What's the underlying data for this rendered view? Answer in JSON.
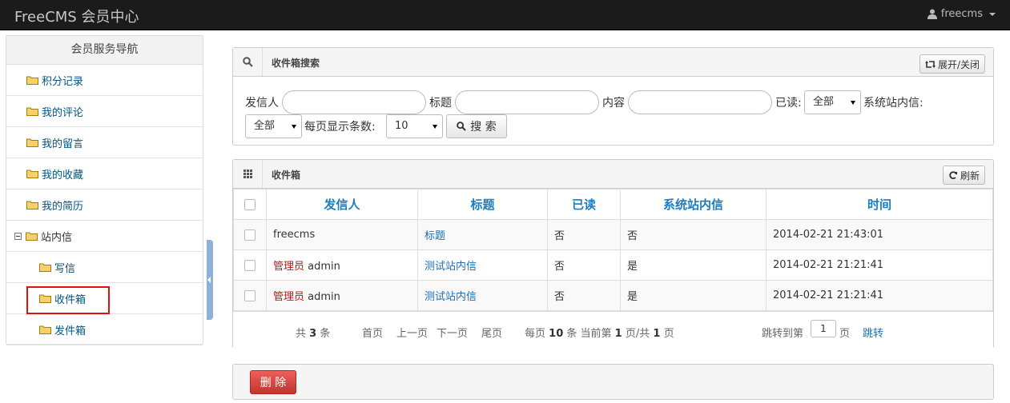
{
  "app": {
    "title": "FreeCMS 会员中心",
    "user": "freecms"
  },
  "sidebar": {
    "title": "会员服务导航",
    "items": [
      {
        "label": "积分记录"
      },
      {
        "label": "我的评论"
      },
      {
        "label": "我的留言"
      },
      {
        "label": "我的收藏"
      },
      {
        "label": "我的简历"
      },
      {
        "label": "站内信"
      },
      {
        "label": "写信"
      },
      {
        "label": "收件箱"
      },
      {
        "label": "发件箱"
      }
    ],
    "active": "收件箱"
  },
  "search": {
    "title": "收件箱搜索",
    "toggle_label": "展开/关闭",
    "sender_label": "发信人",
    "title_label": "标题",
    "content_label": "内容",
    "read_label": "已读:",
    "read_value": "全部",
    "system_label": "系统站内信:",
    "system_value": "全部",
    "pagesize_label": "每页显示条数:",
    "pagesize_value": "10",
    "search_button": "搜 索"
  },
  "list": {
    "title": "收件箱",
    "refresh_label": "刷新",
    "columns": [
      "发信人",
      "标题",
      "已读",
      "系统站内信",
      "时间"
    ],
    "rows": [
      {
        "sender_role": "",
        "sender": "freecms",
        "title": "标题",
        "read": "否",
        "system": "否",
        "time": "2014-02-21 21:43:01"
      },
      {
        "sender_role": "管理员",
        "sender": "admin",
        "title": "测试站内信",
        "read": "否",
        "system": "是",
        "time": "2014-02-21 21:21:41"
      },
      {
        "sender_role": "管理员",
        "sender": "admin",
        "title": "测试站内信",
        "read": "否",
        "system": "是",
        "time": "2014-02-21 21:21:41"
      }
    ]
  },
  "pager": {
    "total_prefix": "共",
    "total": "3",
    "total_suffix": "条",
    "first": "首页",
    "prev": "上一页",
    "next": "下一页",
    "last": "尾页",
    "per_page_prefix": "每页",
    "per_page": "10",
    "per_page_mid": "条 当前第",
    "current": "1",
    "page_of": "页/共",
    "pages": "1",
    "page_suffix": "页",
    "jump_prefix": "跳转到第",
    "jump_value": "1",
    "jump_suffix": "页",
    "jump_button": "跳转"
  },
  "actions": {
    "delete_label": "删 除"
  },
  "colors": {
    "navbar": "#1b1b1b",
    "link": "#1d6fb0",
    "header_text": "#1d7cc0",
    "danger": "#cc1111",
    "highlight": "#e01010"
  }
}
